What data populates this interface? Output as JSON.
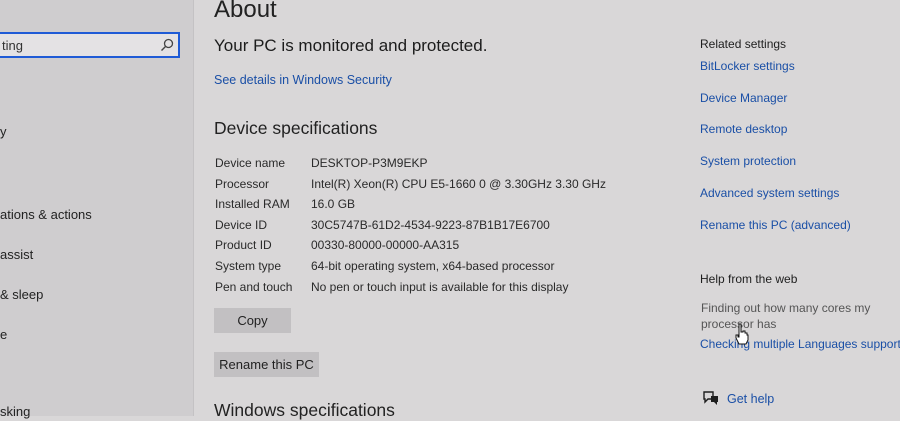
{
  "sidebar": {
    "search_value": "ting",
    "items": [
      {
        "label": "y"
      },
      {
        "label": "ations & actions"
      },
      {
        "label": "assist"
      },
      {
        "label": "& sleep"
      },
      {
        "label": "e"
      },
      {
        "label": "sking"
      }
    ]
  },
  "main": {
    "title": "About",
    "protection_status": "Your PC is monitored and protected.",
    "see_details_link": "See details in Windows Security",
    "device_specs_title": "Device specifications",
    "specs": [
      {
        "label": "Device name",
        "value": "DESKTOP-P3M9EKP"
      },
      {
        "label": "Processor",
        "value": "Intel(R) Xeon(R) CPU E5-1660 0 @ 3.30GHz   3.30 GHz"
      },
      {
        "label": "Installed RAM",
        "value": "16.0 GB"
      },
      {
        "label": "Device ID",
        "value": "30C5747B-61D2-4534-9223-87B1B17E6700"
      },
      {
        "label": "Product ID",
        "value": "00330-80000-00000-AA315"
      },
      {
        "label": "System type",
        "value": "64-bit operating system, x64-based processor"
      },
      {
        "label": "Pen and touch",
        "value": "No pen or touch input is available for this display"
      }
    ],
    "copy_button": "Copy",
    "rename_button": "Rename this PC",
    "windows_specs_title": "Windows specifications"
  },
  "related": {
    "title": "Related settings",
    "links": [
      "BitLocker settings",
      "Device Manager",
      "Remote desktop",
      "System protection",
      "Advanced system settings",
      "Rename this PC (advanced)"
    ],
    "help_title": "Help from the web",
    "help_text": "Finding out how many cores my processor has",
    "help_link": "Checking multiple Languages support",
    "get_help": "Get help"
  },
  "colors": {
    "accent": "#1f5bd6",
    "link": "#1a4fa6"
  }
}
